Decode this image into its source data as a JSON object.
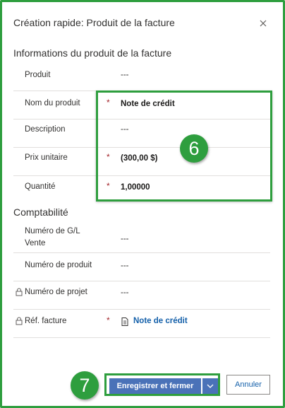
{
  "dialog": {
    "title": "Création rapide: Produit de la facture",
    "close_icon": "close-icon"
  },
  "section_info": {
    "title": "Informations du produit de la facture",
    "fields": [
      {
        "label": "Produit",
        "value": "---",
        "required": false
      },
      {
        "label": "Nom du produit",
        "value": "Note de crédit",
        "required": true
      },
      {
        "label": "Description",
        "value": "---",
        "required": false
      },
      {
        "label": "Prix unitaire",
        "value": "(300,00 $)",
        "required": true
      },
      {
        "label": "Quantité",
        "value": "1,00000",
        "required": true
      }
    ]
  },
  "section_accounting": {
    "title": "Comptabilité",
    "fields": [
      {
        "label": "Numéro de G/L Vente",
        "value": "---",
        "required": false,
        "locked": false
      },
      {
        "label": "Numéro de produit",
        "value": "---",
        "required": false,
        "locked": false
      },
      {
        "label": "Numéro de projet",
        "value": "---",
        "required": false,
        "locked": true
      },
      {
        "label": "Réf. facture",
        "value": "Note de crédit",
        "required": true,
        "locked": true,
        "link": true,
        "icon": "document-icon"
      }
    ]
  },
  "required_marker": "*",
  "badges": {
    "fields_callout": "6",
    "save_callout": "7"
  },
  "footer": {
    "save_label": "Enregistrer et fermer",
    "cancel_label": "Annuler"
  },
  "colors": {
    "callout_green": "#2e9e3e",
    "primary_button": "#4a72b8",
    "link": "#1460aa",
    "required": "#a4262c"
  }
}
